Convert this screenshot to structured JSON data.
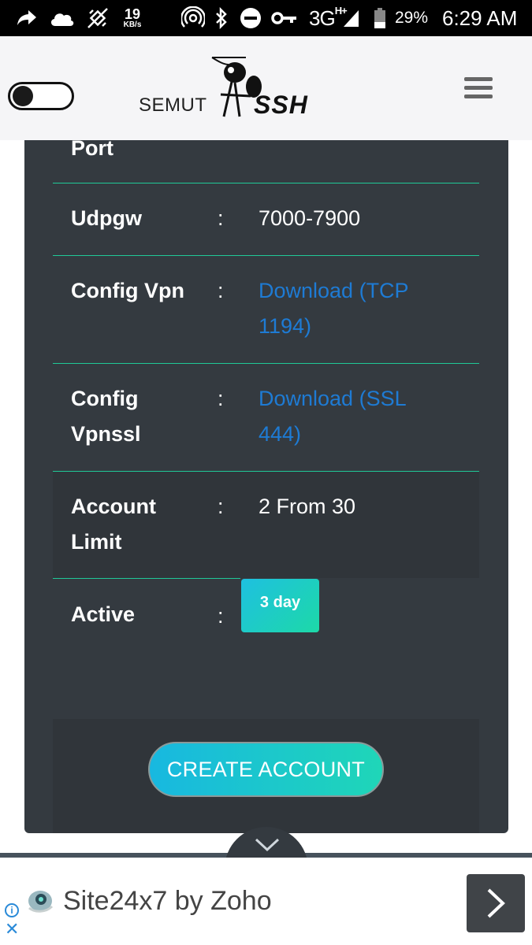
{
  "status_bar": {
    "net_speed_value": "19",
    "net_speed_unit": "KB/s",
    "network_type": "3G",
    "network_sup": "H+",
    "battery": "29%",
    "time": "6:29 AM"
  },
  "header": {
    "logo_text": "SEMUT",
    "logo_ssh": "SSH"
  },
  "details": {
    "port_label": "Port",
    "rows": [
      {
        "label": "Udpgw",
        "value": "7000-7900"
      },
      {
        "label": "Config Vpn",
        "value": "Download (TCP 1194)"
      },
      {
        "label": "Config Vpnssl",
        "value": "Download (SSL 444)"
      },
      {
        "label": "Account Limit",
        "value": "2 From 30"
      },
      {
        "label": "Active",
        "value": "3 day"
      }
    ],
    "separator": ":"
  },
  "create_button": "CREATE ACCOUNT",
  "ad": {
    "title": "Site24x7 by Zoho",
    "info_glyph": "i",
    "close_glyph": "✕"
  },
  "colors": {
    "card_bg": "#343a40",
    "divider": "#20c997",
    "link": "#1e7bd4",
    "accent_gradient_start": "#18b8e0",
    "accent_gradient_end": "#1fd6b8"
  }
}
